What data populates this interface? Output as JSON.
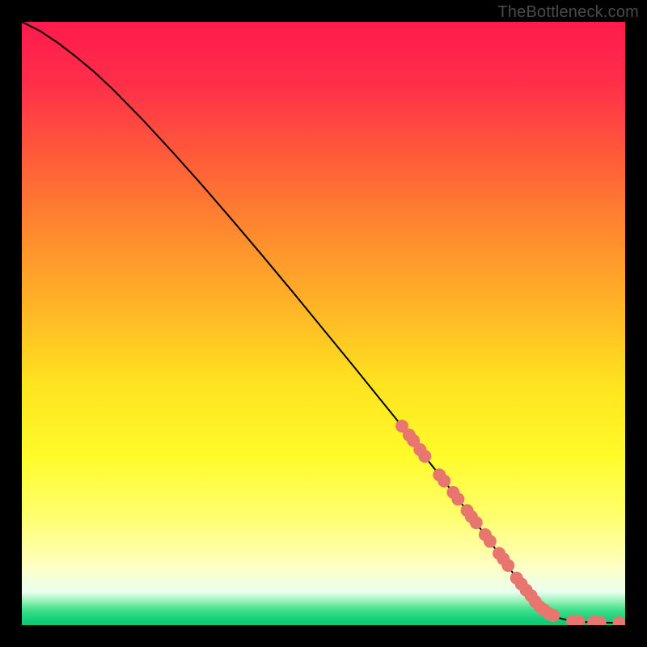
{
  "watermark": "TheBottleneck.com",
  "colors": {
    "background": "#000000",
    "gradient_stops": [
      {
        "offset": 0.0,
        "color": "#ff1a4d"
      },
      {
        "offset": 0.1,
        "color": "#ff2e49"
      },
      {
        "offset": 0.22,
        "color": "#ff5a3a"
      },
      {
        "offset": 0.35,
        "color": "#ff8a2e"
      },
      {
        "offset": 0.48,
        "color": "#ffb726"
      },
      {
        "offset": 0.6,
        "color": "#ffe31f"
      },
      {
        "offset": 0.72,
        "color": "#fffb2a"
      },
      {
        "offset": 0.82,
        "color": "#ffff6e"
      },
      {
        "offset": 0.9,
        "color": "#ffffc0"
      },
      {
        "offset": 0.945,
        "color": "#eafff0"
      },
      {
        "offset": 0.96,
        "color": "#96f2b6"
      },
      {
        "offset": 0.975,
        "color": "#3fe08b"
      },
      {
        "offset": 0.99,
        "color": "#18d07a"
      },
      {
        "offset": 1.0,
        "color": "#12c973"
      }
    ],
    "curve": "#000000",
    "marker_fill": "#e9766e",
    "marker_stroke": "#c9574f"
  },
  "chart_data": {
    "type": "line",
    "title": "",
    "xlabel": "",
    "ylabel": "",
    "xlim": [
      0,
      100
    ],
    "ylim": [
      0,
      100
    ],
    "series": [
      {
        "name": "curve",
        "x": [
          0,
          3,
          6,
          9,
          12,
          15,
          20,
          25,
          30,
          35,
          40,
          45,
          50,
          55,
          60,
          63,
          65,
          67,
          70,
          72,
          74,
          76,
          78,
          80,
          82,
          84,
          86,
          87.5,
          89,
          90.5,
          92,
          94,
          96,
          98,
          100
        ],
        "y": [
          100,
          98.5,
          96.5,
          94.2,
          91.7,
          88.9,
          83.8,
          78.4,
          72.8,
          67.0,
          61.1,
          55.1,
          49.0,
          42.9,
          36.7,
          33.0,
          30.5,
          27.7,
          23.9,
          21.3,
          18.7,
          16.0,
          13.3,
          10.6,
          7.8,
          5.2,
          2.8,
          1.8,
          1.2,
          0.82,
          0.62,
          0.48,
          0.42,
          0.4,
          0.4
        ]
      }
    ],
    "markers": {
      "x": [
        63.0,
        64.2,
        64.9,
        66.0,
        66.8,
        69.2,
        70.0,
        71.5,
        72.3,
        73.8,
        74.5,
        75.3,
        76.8,
        77.6,
        79.1,
        79.8,
        80.6,
        82.0,
        82.8,
        83.6,
        84.4,
        85.1,
        85.9,
        86.6,
        87.4,
        88.1,
        91.3,
        92.3,
        94.8,
        95.8,
        99.0
      ],
      "y": [
        33.0,
        31.5,
        30.6,
        29.1,
        28.0,
        24.9,
        23.9,
        22.0,
        20.9,
        19.0,
        18.0,
        17.0,
        15.0,
        13.9,
        11.9,
        11.0,
        9.9,
        7.8,
        6.8,
        5.8,
        4.9,
        3.9,
        3.0,
        2.5,
        1.9,
        1.6,
        0.65,
        0.6,
        0.5,
        0.47,
        0.4
      ],
      "r": 8
    }
  }
}
